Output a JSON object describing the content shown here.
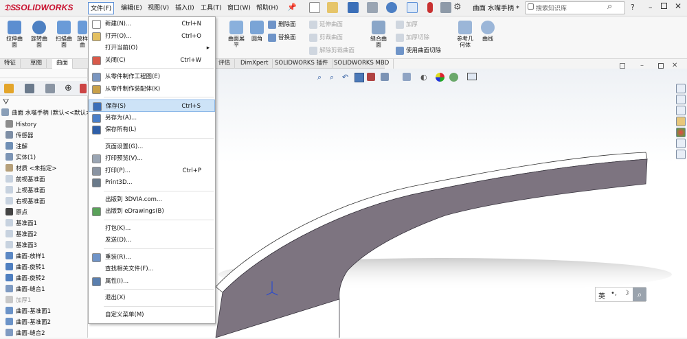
{
  "app": {
    "brand": "SOLIDWORKS",
    "doc_title": "曲面 水嘴手柄 *"
  },
  "menubar": [
    "文件(F)",
    "编辑(E)",
    "视图(V)",
    "插入(I)",
    "工具(T)",
    "窗口(W)",
    "帮助(H)"
  ],
  "search": {
    "placeholder": "搜索知识库"
  },
  "ribbon": {
    "large": [
      {
        "label": "拉伸曲\n面"
      },
      {
        "label": "旋转曲\n面"
      },
      {
        "label": "扫描曲\n面"
      },
      {
        "label": "放样\n曲"
      }
    ],
    "mid": [
      {
        "label": "曲面展\n平"
      },
      {
        "label": "圆角"
      }
    ],
    "small_a": [
      {
        "label": "删除面",
        "disabled": false
      },
      {
        "label": "替换面",
        "disabled": false
      }
    ],
    "small_b": [
      {
        "label": "延伸曲面",
        "disabled": true
      },
      {
        "label": "剪裁曲面",
        "disabled": true
      },
      {
        "label": "解除剪裁曲面",
        "disabled": true
      }
    ],
    "knit": {
      "label": "缝合曲\n面"
    },
    "small_c": [
      {
        "label": "加厚",
        "disabled": true
      },
      {
        "label": "加厚切除",
        "disabled": true
      },
      {
        "label": "使用曲面切除",
        "disabled": false
      }
    ],
    "ref": {
      "label": "参考几\n何体"
    },
    "curve": {
      "label": "曲线"
    }
  },
  "tabs": [
    "特征",
    "草图",
    "曲面",
    "评估",
    "DimXpert",
    "SOLIDWORKS 插件",
    "SOLIDWORKS MBD"
  ],
  "tree": {
    "root": "曲面 水嘴手柄 (默认<<默认>",
    "items": [
      {
        "label": "History",
        "icon": "history-icon"
      },
      {
        "label": "传感器",
        "icon": "sensor-icon"
      },
      {
        "label": "注解",
        "icon": "annotation-icon"
      },
      {
        "label": "实体(1)",
        "icon": "solid-body-icon"
      },
      {
        "label": "材质 <未指定>",
        "icon": "material-icon"
      },
      {
        "label": "前视基准面",
        "icon": "plane-icon"
      },
      {
        "label": "上视基准面",
        "icon": "plane-icon"
      },
      {
        "label": "右视基准面",
        "icon": "plane-icon"
      },
      {
        "label": "原点",
        "icon": "origin-icon"
      },
      {
        "label": "基准面1",
        "icon": "plane-icon"
      },
      {
        "label": "基准面2",
        "icon": "plane-icon"
      },
      {
        "label": "基准面3",
        "icon": "plane-icon"
      },
      {
        "label": "曲面-放样1",
        "icon": "loft-surface-icon"
      },
      {
        "label": "曲面-旋转1",
        "icon": "revolve-surface-icon"
      },
      {
        "label": "曲面-旋转2",
        "icon": "revolve-surface-icon"
      },
      {
        "label": "曲面-缝合1",
        "icon": "knit-surface-icon"
      },
      {
        "label": "加厚1",
        "icon": "thicken-icon"
      },
      {
        "label": "曲面-基准面1",
        "icon": "planar-surface-icon"
      },
      {
        "label": "曲面-基准面2",
        "icon": "planar-surface-icon"
      },
      {
        "label": "曲面-缝合2",
        "icon": "knit-surface-icon"
      }
    ]
  },
  "file_menu": [
    {
      "label": "新建(N)...",
      "shortcut": "Ctrl+N",
      "icon": "new-icon"
    },
    {
      "label": "打开(O)...",
      "shortcut": "Ctrl+O",
      "icon": "open-icon"
    },
    {
      "label": "打开当前(O)",
      "shortcut": "",
      "icon": "",
      "submenu": true
    },
    {
      "label": "关闭(C)",
      "shortcut": "Ctrl+W",
      "icon": "close-doc-icon"
    },
    {
      "sep": true
    },
    {
      "label": "从零件制作工程图(E)",
      "shortcut": "",
      "icon": "make-drawing-icon"
    },
    {
      "label": "从零件制作装配体(K)",
      "shortcut": "",
      "icon": "make-assembly-icon"
    },
    {
      "sep": true
    },
    {
      "label": "保存(S)",
      "shortcut": "Ctrl+S",
      "icon": "save-icon",
      "highlight": true
    },
    {
      "label": "另存为(A)...",
      "shortcut": "",
      "icon": "save-as-icon"
    },
    {
      "label": "保存所有(L)",
      "shortcut": "",
      "icon": "save-all-icon"
    },
    {
      "sep": true
    },
    {
      "label": "页面设置(G)...",
      "shortcut": "",
      "icon": ""
    },
    {
      "label": "打印预览(V)...",
      "shortcut": "",
      "icon": "print-preview-icon"
    },
    {
      "label": "打印(P)...",
      "shortcut": "Ctrl+P",
      "icon": "print-icon"
    },
    {
      "label": "Print3D...",
      "shortcut": "",
      "icon": "print3d-icon"
    },
    {
      "sep": true
    },
    {
      "label": "出版到 3DVIA.com...",
      "shortcut": "",
      "icon": ""
    },
    {
      "label": "出版到 eDrawings(B)",
      "shortcut": "",
      "icon": "edrawings-icon"
    },
    {
      "sep": true
    },
    {
      "label": "打包(K)...",
      "shortcut": "",
      "icon": ""
    },
    {
      "label": "发送(D)...",
      "shortcut": "",
      "icon": ""
    },
    {
      "sep": true
    },
    {
      "label": "重装(R)...",
      "shortcut": "",
      "icon": "reload-icon"
    },
    {
      "label": "查找相关文件(F)...",
      "shortcut": "",
      "icon": ""
    },
    {
      "label": "属性(I)...",
      "shortcut": "",
      "icon": "properties-icon"
    },
    {
      "sep": true
    },
    {
      "label": "退出(X)",
      "shortcut": "",
      "icon": ""
    },
    {
      "sep": true
    },
    {
      "label": "自定义菜单(M)",
      "shortcut": "",
      "icon": ""
    }
  ],
  "ime": {
    "label": "英"
  },
  "colors": {
    "accent": "#2f6fc6",
    "part": "#7d7480",
    "part_top": "#ffffff"
  }
}
